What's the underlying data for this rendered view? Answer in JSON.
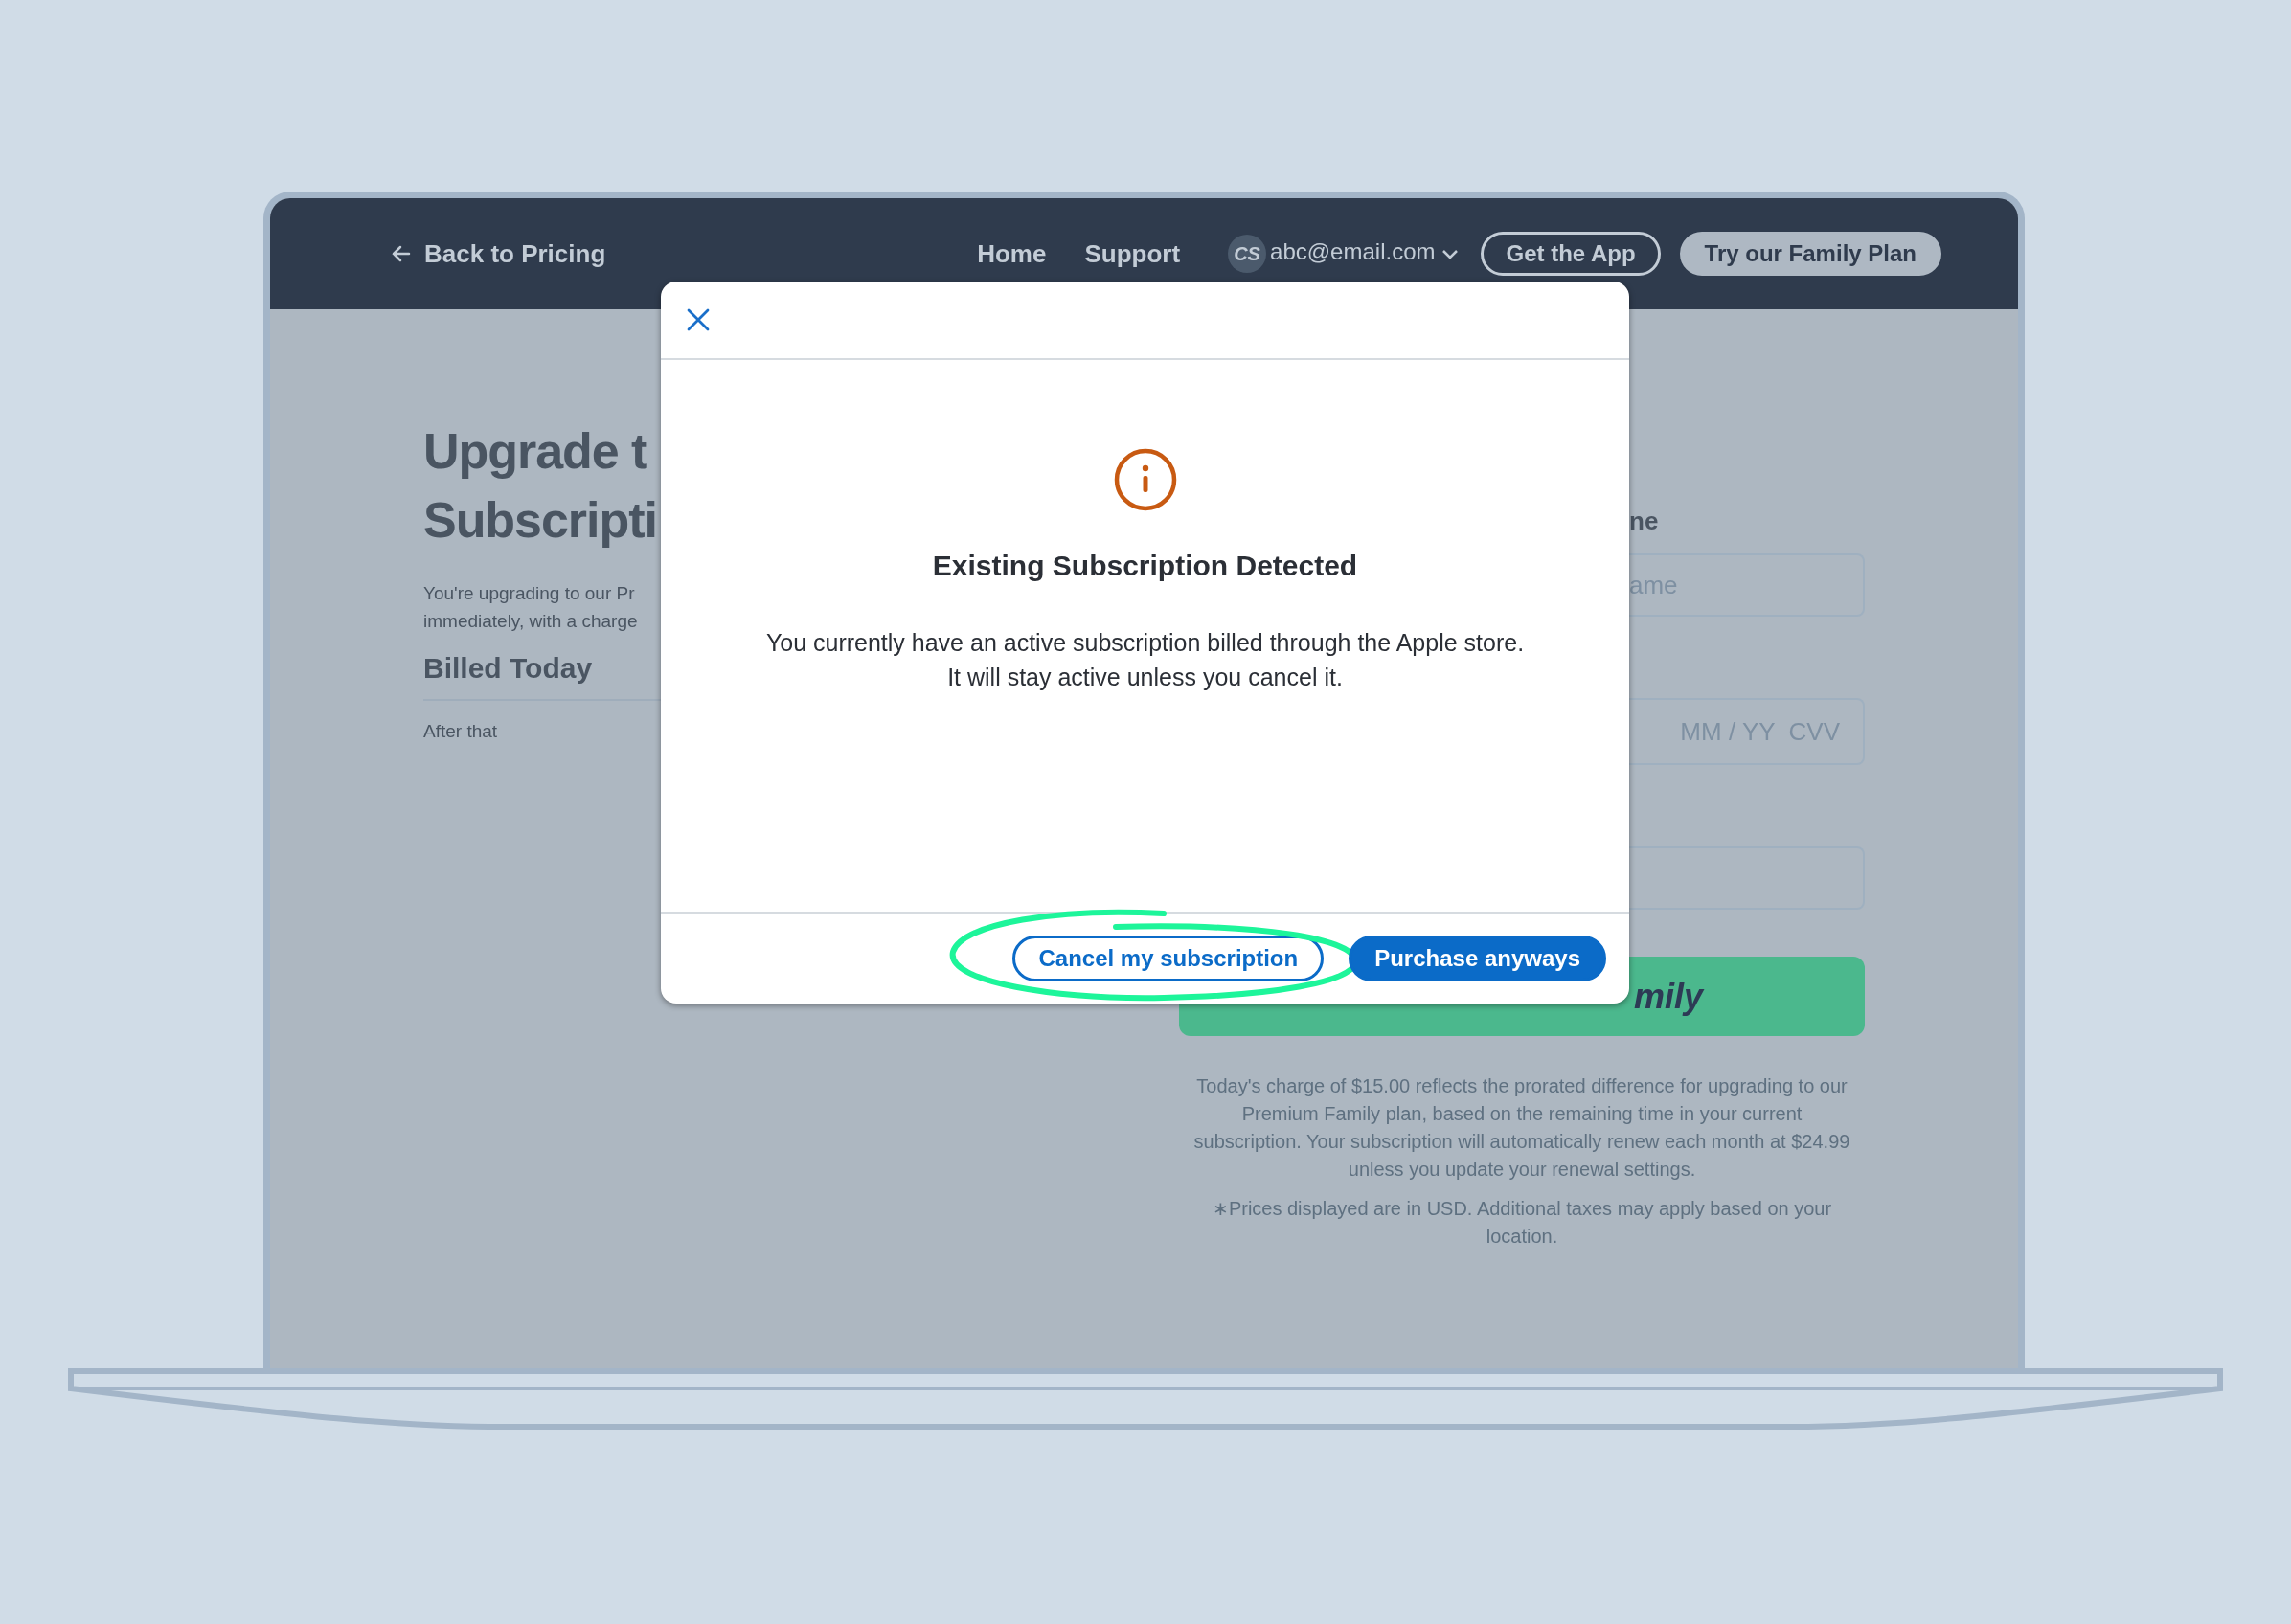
{
  "nav": {
    "back_link": "Back to Pricing",
    "links": [
      "Home",
      "Support"
    ],
    "account": {
      "initials": "CS",
      "email": "abc@email.com"
    },
    "buttons": [
      {
        "label": "Get the App",
        "kind": "outline"
      },
      {
        "label": "Try our Family Plan",
        "kind": "filled"
      }
    ]
  },
  "page": {
    "heading_lines": [
      "Upgrade t",
      "Subscripti"
    ],
    "intro_lines": [
      "You're upgrading to our Pr",
      "immediately, with a charge"
    ],
    "billed_heading": "Billed Today",
    "after_label": "After that",
    "form": {
      "label": "ne",
      "fields": [
        {
          "kind": "text",
          "placeholder": "ame"
        },
        {
          "kind": "card",
          "placeholder": "MM / YY  CVV"
        },
        {
          "kind": "blank"
        }
      ],
      "submit": "mily",
      "notes": [
        "Today's charge of $15.00 reflects the prorated difference for upgrading to our Premium Family plan, based on the remaining time in your current subscription. Your subscription will automatically renew each month at $24.99 unless you update your renewal settings.",
        "∗Prices displayed are in USD. Additional taxes may apply based on your location."
      ]
    }
  },
  "modal": {
    "title": "Existing Subscription Detected",
    "body_lines": [
      "You currently have an active subscription billed through the Apple store.",
      "It will stay active unless you cancel it."
    ],
    "buttons": [
      {
        "label": "Cancel my subscription",
        "kind": "secondary",
        "highlighted": true
      },
      {
        "label": "Purchase anyways",
        "kind": "primary",
        "highlighted": false
      }
    ]
  }
}
